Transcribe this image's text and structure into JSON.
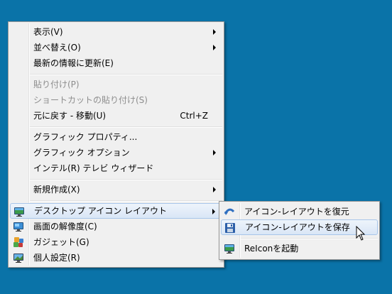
{
  "main_menu": {
    "items": [
      {
        "label": "表示(V)",
        "submenu": true
      },
      {
        "label": "並べ替え(O)",
        "submenu": true
      },
      {
        "label": "最新の情報に更新(E)"
      },
      {
        "label": "貼り付け(P)",
        "disabled": true
      },
      {
        "label": "ショートカットの貼り付け(S)",
        "disabled": true
      },
      {
        "label": "元に戻す - 移動(U)",
        "accel": "Ctrl+Z"
      },
      {
        "label": "グラフィック プロパティ..."
      },
      {
        "label": "グラフィック オプション",
        "submenu": true
      },
      {
        "label": "インテル(R) テレビ ウィザード"
      },
      {
        "label": "新規作成(X)",
        "submenu": true
      },
      {
        "label": "デスクトップ アイコン レイアウト",
        "submenu": true,
        "icon": "desktop-monitor-icon",
        "highlighted": true
      },
      {
        "label": "画面の解像度(C)",
        "icon": "display-resolution-icon"
      },
      {
        "label": "ガジェット(G)",
        "icon": "gadgets-icon"
      },
      {
        "label": "個人設定(R)",
        "icon": "personalize-icon"
      }
    ]
  },
  "sub_menu": {
    "items": [
      {
        "label": "アイコン-レイアウトを復元",
        "icon": "restore-arrow-icon"
      },
      {
        "label": "アイコン-レイアウトを保存",
        "icon": "save-disk-icon",
        "highlighted": true
      },
      {
        "label": "ReIconを起動",
        "icon": "reicon-monitor-icon"
      }
    ]
  },
  "colors": {
    "desktop": "#0a73a8",
    "menu_bg": "#f0f0f0",
    "highlight_border": "#a8c6ea"
  }
}
